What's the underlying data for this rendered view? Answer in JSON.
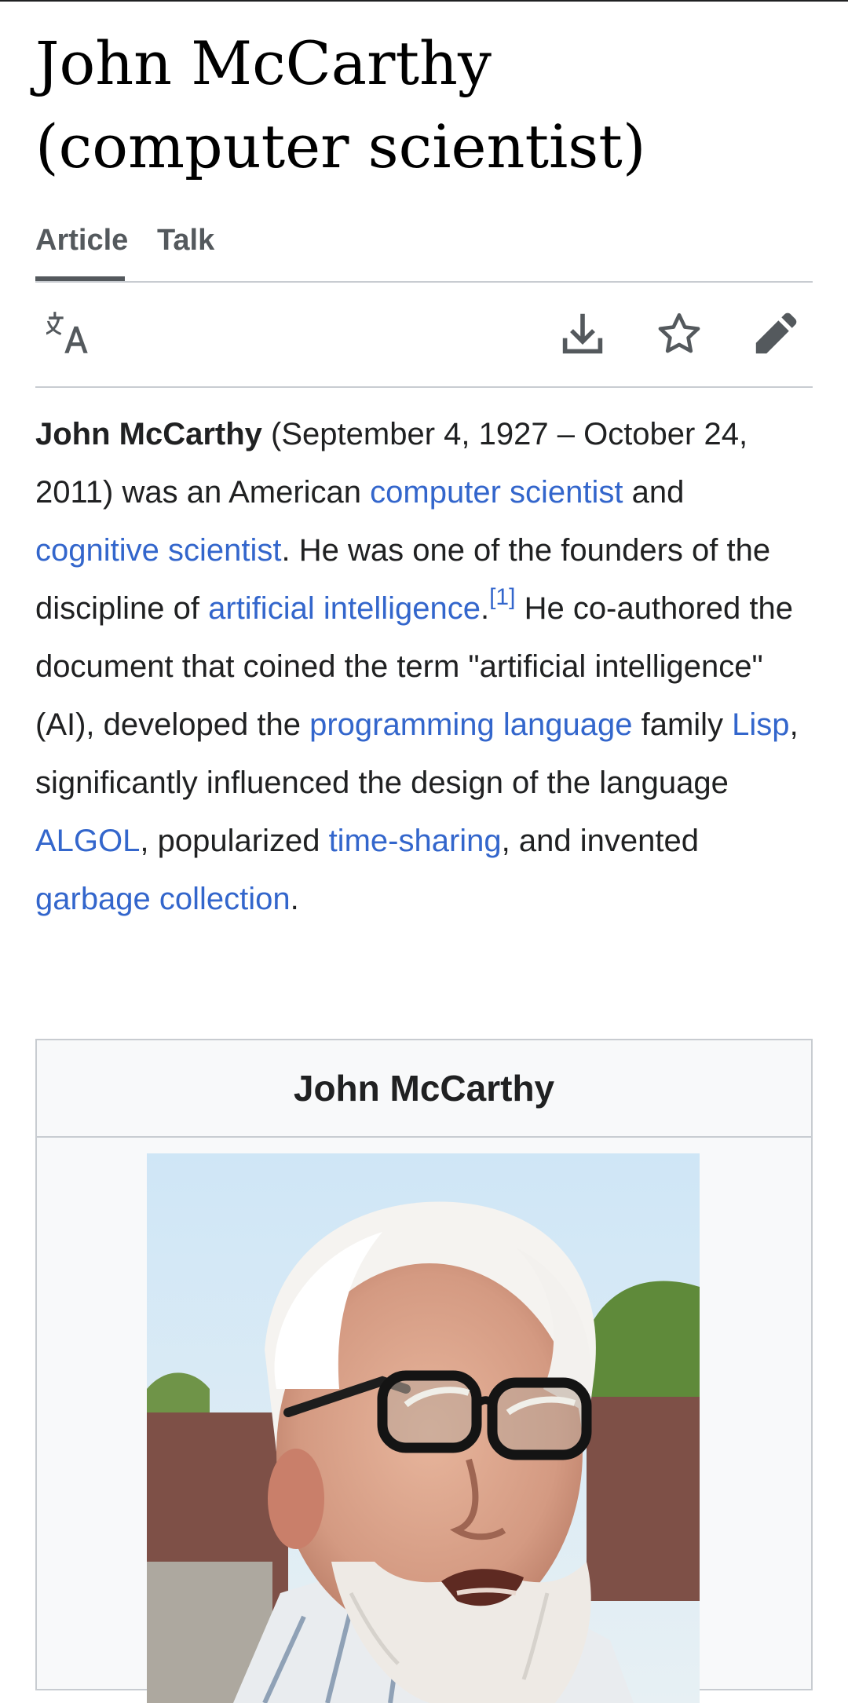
{
  "title": "John McCarthy (computer scientist)",
  "tabs": [
    {
      "label": "Article",
      "selected": true
    },
    {
      "label": "Talk",
      "selected": false
    }
  ],
  "toolbar": {
    "icons": [
      "language-icon",
      "download-icon",
      "star-icon",
      "edit-icon"
    ]
  },
  "lead": {
    "name": "John McCarthy",
    "t1": " (September 4, 1927 – October 24, 2011) was an American ",
    "link1": "computer scientist",
    "t2": " and ",
    "link2": "cognitive scientist",
    "t3": ". He was one of the founders of the discipline of ",
    "link3": "artificial intelligence",
    "t4": ".",
    "ref": "[1]",
    "t5": " He co-authored the document that coined the term \"artificial intelligence\" (AI), developed the ",
    "link4": "programming language",
    "t6": " family ",
    "link5": "Lisp",
    "t7": ", significantly influenced the design of the language ",
    "link6": "ALGOL",
    "t8": ", popularized ",
    "link7": "time-sharing",
    "t9": ", and invented ",
    "link8": "garbage collection",
    "t10": "."
  },
  "infobox": {
    "title": "John McCarthy"
  },
  "colors": {
    "link": "#3366cc",
    "text": "#202122",
    "border": "#c8ccd1",
    "icon": "#54595d",
    "infobox_bg": "#f8f9fa"
  }
}
